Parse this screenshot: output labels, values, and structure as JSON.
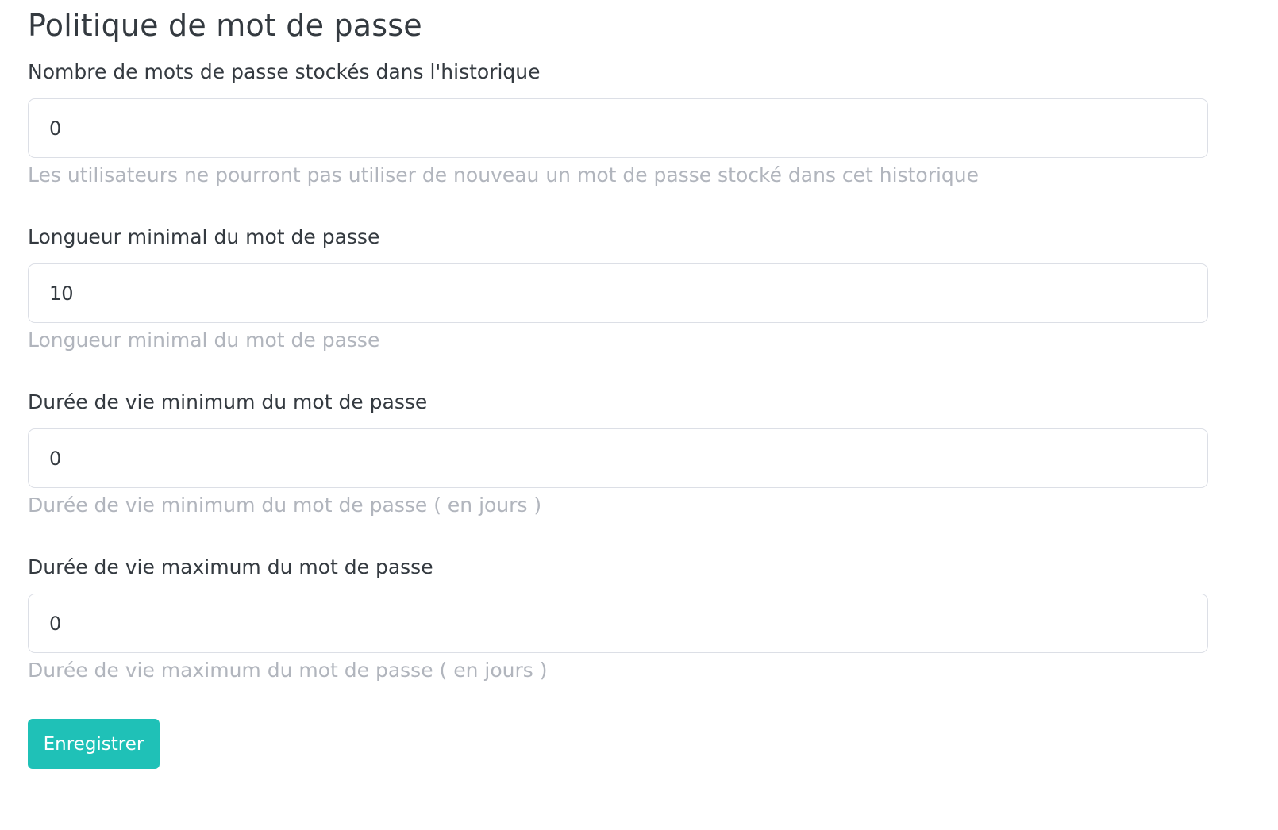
{
  "page": {
    "title": "Politique de mot de passe"
  },
  "fields": [
    {
      "label": "Nombre de mots de passe stockés dans l'historique",
      "value": "0",
      "help": "Les utilisateurs ne pourront pas utiliser de nouveau un mot de passe stocké dans cet historique"
    },
    {
      "label": "Longueur minimal du mot de passe",
      "value": "10",
      "help": "Longueur minimal du mot de passe"
    },
    {
      "label": "Durée de vie minimum du mot de passe",
      "value": "0",
      "help": "Durée de vie minimum du mot de passe ( en jours )"
    },
    {
      "label": "Durée de vie maximum du mot de passe",
      "value": "0",
      "help": "Durée de vie maximum du mot de passe ( en jours )"
    }
  ],
  "actions": {
    "save_label": "Enregistrer"
  },
  "colors": {
    "accent": "#1fc1b7",
    "text": "#343a40",
    "help_text": "#b1b5bd",
    "input_border": "#dcdfe6"
  }
}
